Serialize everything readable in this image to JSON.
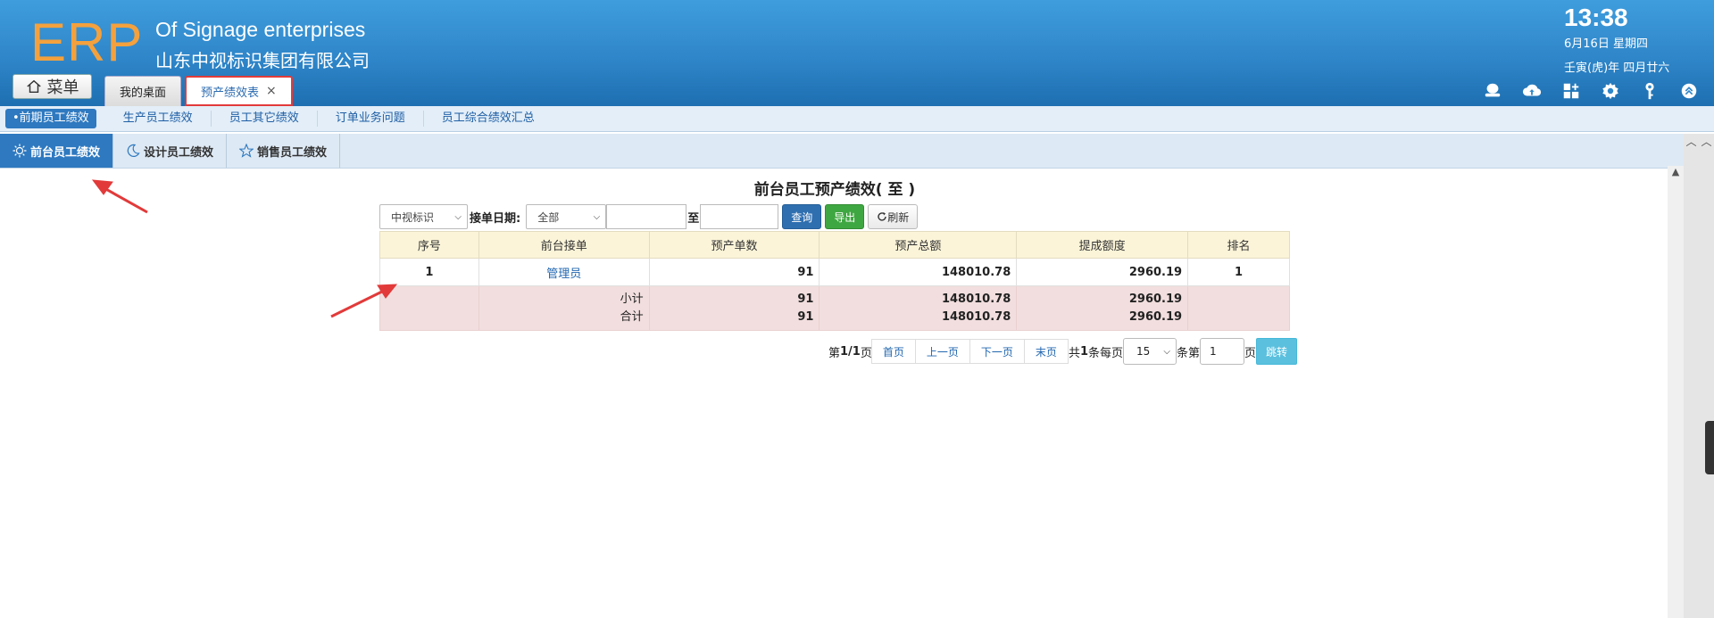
{
  "header": {
    "logo": "ERP",
    "company_en": "Of Signage enterprises",
    "company_cn": "山东中视标识集团有限公司",
    "time": "13:38",
    "date": "6月16日 星期四",
    "lunar": "壬寅(虎)年 四月廿六",
    "menu_label": "菜单",
    "tabs": [
      {
        "label": "我的桌面"
      },
      {
        "label": "预产绩效表",
        "close": "×"
      }
    ]
  },
  "subnav": {
    "items": [
      {
        "label": "•前期员工绩效"
      },
      {
        "label": "生产员工绩效"
      },
      {
        "label": "员工其它绩效"
      },
      {
        "label": "订单业务问题"
      },
      {
        "label": "员工综合绩效汇总"
      }
    ]
  },
  "inner_tabs": [
    {
      "label": "前台员工绩效"
    },
    {
      "label": "设计员工绩效"
    },
    {
      "label": "销售员工绩效"
    }
  ],
  "report": {
    "title": "前台员工预产绩效( 至 )",
    "company_select": "中视标识",
    "date_label": "接单日期:",
    "range_select": "全部",
    "to_label": "至",
    "query_btn": "查询",
    "export_btn": "导出",
    "refresh_btn": "刷新"
  },
  "table": {
    "headers": [
      "序号",
      "前台接单",
      "预产单数",
      "预产总额",
      "提成额度",
      "排名"
    ],
    "rows": [
      {
        "index": "1",
        "name": "管理员",
        "orders": "91",
        "total": "148010.78",
        "commission": "2960.19",
        "rank": "1"
      }
    ],
    "subtotal_label": "小计",
    "total_label": "合计",
    "subtotal": {
      "orders": "91",
      "total": "148010.78",
      "commission": "2960.19"
    },
    "grand": {
      "orders": "91",
      "total": "148010.78",
      "commission": "2960.19"
    }
  },
  "pager": {
    "page_prefix": "第",
    "page_info": "1/1",
    "page_suffix": "页",
    "first": "首页",
    "prev": "上一页",
    "next": "下一页",
    "last": "末页",
    "total_prefix": "共",
    "total_count": "1",
    "total_suffix": "条每页",
    "page_size": "15",
    "goto_prefix": "条第",
    "goto_value": "1",
    "goto_suffix": "页",
    "go": "跳转"
  },
  "colors": {
    "header_blue": "#2f86c9",
    "logo_orange": "#f4a13d",
    "active_blue": "#2e79c0",
    "summary_pink": "#f2dede",
    "header_yellow": "#fbf4d8",
    "annotation_red": "#e23a3a"
  }
}
